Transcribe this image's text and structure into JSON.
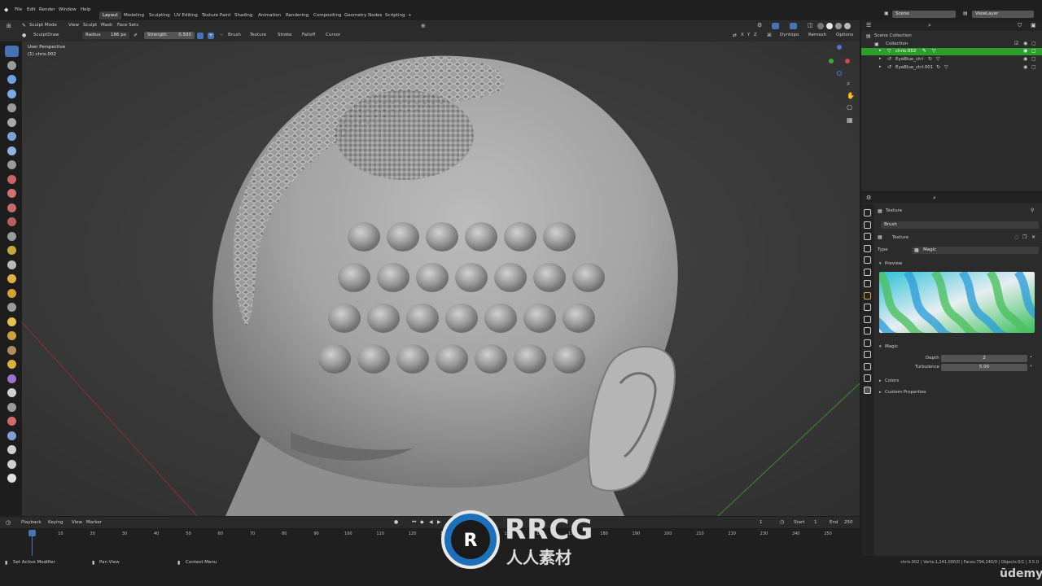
{
  "menu": [
    "File",
    "Edit",
    "Render",
    "Window",
    "Help"
  ],
  "workspaces": [
    "Layout",
    "Modeling",
    "Sculpting",
    "UV Editing",
    "Texture Paint",
    "Shading",
    "Animation",
    "Rendering",
    "Compositing",
    "Geometry Nodes",
    "Scripting"
  ],
  "workspace_add": "+",
  "scene_label": "Scene",
  "view_layer_label": "ViewLayer",
  "header": {
    "mode": "Sculpt Mode",
    "menus": [
      "View",
      "Sculpt",
      "Mask",
      "Face Sets"
    ],
    "brush_name": "SculptDraw",
    "radius_label": "Radius",
    "radius_value": "186 px",
    "strength_label": "Strength",
    "strength_value": "0.500",
    "dropdowns": [
      "Brush",
      "Texture",
      "Stroke",
      "Falloff",
      "Cursor"
    ],
    "axes": [
      "X",
      "Y",
      "Z"
    ],
    "dyntopo": "Dyntopo",
    "remesh": "Remesh",
    "options": "Options"
  },
  "viewport": {
    "perspective": "User Perspective",
    "object": "(1) chris.002"
  },
  "outliner": {
    "root": "Scene Collection",
    "collection": "Collection",
    "items": [
      "chris.002",
      "EyeBlue_ctrl",
      "EyeBlue_ctrl.001"
    ]
  },
  "properties": {
    "context": "Texture",
    "brush_slot": "Brush",
    "texture_name": "Texture",
    "type_label": "Type",
    "type_value": "Magic",
    "preview_label": "Preview",
    "magic_label": "Magic",
    "depth_label": "Depth",
    "depth_value": "2",
    "turbulence_label": "Turbulence",
    "turbulence_value": "5.00",
    "colors_label": "Colors",
    "custom_label": "Custom Properties"
  },
  "timeline": {
    "menus": [
      "Playback",
      "Keying",
      "View",
      "Marker"
    ],
    "current_frame": "1",
    "start_label": "Start",
    "start_value": "1",
    "end_label": "End",
    "end_value": "250",
    "ticks": [
      "1",
      "10",
      "20",
      "30",
      "40",
      "50",
      "60",
      "70",
      "80",
      "90",
      "100",
      "110",
      "120",
      "130",
      "140",
      "150",
      "160",
      "170",
      "180",
      "190",
      "200",
      "210",
      "220",
      "230",
      "240",
      "250"
    ]
  },
  "status": {
    "left": "Set Active Modifier",
    "middle": "Pan View",
    "right": "Context Menu",
    "stats": "chris.002 | Verts:1,241,000/0 | Faces:794,240/0 | Objects:0/1 | 3.5.0"
  },
  "watermark": {
    "brand": "RRCG",
    "subtitle": "人人素材",
    "udemy": "ūdemy"
  },
  "colors": {
    "accent": "#4772b3",
    "selected_row": "#2c9e2c",
    "viewport_bg": "#3d3d3d"
  }
}
